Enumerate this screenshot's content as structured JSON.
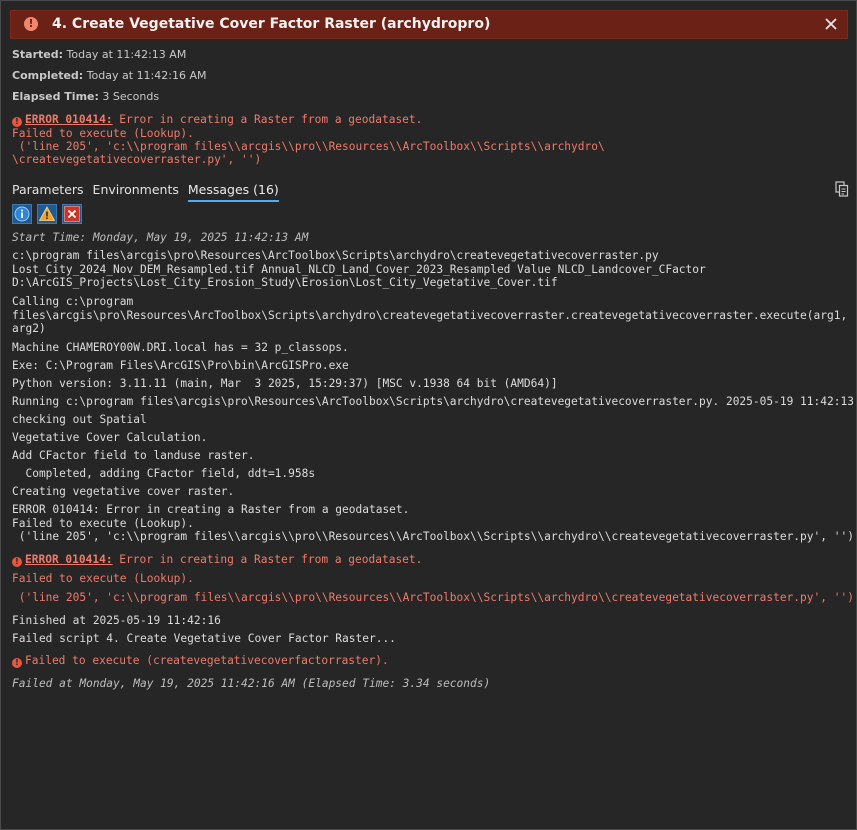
{
  "window": {
    "title": "4. Create Vegetative Cover Factor Raster (archydropro)"
  },
  "meta": {
    "started_label": "Started:",
    "started_value": "Today at 11:42:13 AM",
    "completed_label": "Completed:",
    "completed_value": "Today at 11:42:16 AM",
    "elapsed_label": "Elapsed Time:",
    "elapsed_value": "3 Seconds"
  },
  "summary_error": {
    "code": "ERROR 010414:",
    "text": " Error in creating a Raster from a geodataset.",
    "line2": "Failed to execute (Lookup).",
    "line3": " ('line 205', 'c:\\\\program files\\\\arcgis\\\\pro\\\\Resources\\\\ArcToolbox\\\\Scripts\\\\archydro\\",
    "line4": "\\createvegetativecoverraster.py', '')"
  },
  "tabs": [
    {
      "label": "Parameters"
    },
    {
      "label": "Environments"
    },
    {
      "label": "Messages (16)"
    }
  ],
  "filters": {
    "info_icon": "info-icon",
    "warning_icon": "warning-icon",
    "error_icon": "error-icon"
  },
  "messages": {
    "start_time": "Start Time: Monday, May 19, 2025 11:42:13 AM",
    "m1_l1": "c:\\program files\\arcgis\\pro\\Resources\\ArcToolbox\\Scripts\\archydro\\createvegetativecoverraster.py",
    "m1_l2": "Lost_City_2024_Nov_DEM_Resampled.tif Annual_NLCD_Land_Cover_2023_Resampled Value NLCD_Landcover_CFactor",
    "m1_l3": "D:\\ArcGIS_Projects\\Lost_City_Erosion_Study\\Erosion\\Lost_City_Vegetative_Cover.tif",
    "m2_l1": "Calling c:\\program",
    "m2_l2": "files\\arcgis\\pro\\Resources\\ArcToolbox\\Scripts\\archydro\\createvegetativecoverraster.createvegetativecoverraster.execute(arg1,",
    "m2_l3": "arg2)",
    "m3": "Machine CHAMEROY00W.DRI.local has = 32 p_classops.",
    "m4": "Exe: C:\\Program Files\\ArcGIS\\Pro\\bin\\ArcGISPro.exe",
    "m5": "Python version: 3.11.11 (main, Mar  3 2025, 15:29:37) [MSC v.1938 64 bit (AMD64)]",
    "m6": "Running c:\\program files\\arcgis\\pro\\Resources\\ArcToolbox\\Scripts\\archydro\\createvegetativecoverraster.py. 2025-05-19 11:42:13",
    "m7": "checking out Spatial",
    "m8": "Vegetative Cover Calculation.",
    "m9": "Add CFactor field to landuse raster.",
    "m10": "  Completed, adding CFactor field, ddt=1.958s",
    "m11": "Creating vegetative cover raster.",
    "m12_l1": "ERROR 010414: Error in creating a Raster from a geodataset.",
    "m12_l2": "Failed to execute (Lookup).",
    "m12_l3": " ('line 205', 'c:\\\\program files\\\\arcgis\\\\pro\\\\Resources\\\\ArcToolbox\\\\Scripts\\\\archydro\\\\createvegetativecoverraster.py', '')",
    "e1_code": "ERROR 010414:",
    "e1_text": " Error in creating a Raster from a geodataset.",
    "e1_l2": "Failed to execute (Lookup).",
    "e1_l3": " ('line 205', 'c:\\\\program files\\\\arcgis\\\\pro\\\\Resources\\\\ArcToolbox\\\\Scripts\\\\archydro\\\\createvegetativecoverraster.py', '')",
    "m13": "Finished at 2025-05-19 11:42:16",
    "m14": "Failed script 4. Create Vegetative Cover Factor Raster...",
    "e2": "Failed to execute (createvegetativecoverfactorraster).",
    "end_time": "Failed at Monday, May 19, 2025 11:42:16 AM (Elapsed Time: 3.34 seconds)"
  },
  "colors": {
    "title_bar": "#6b2116",
    "error_text": "#ef7a6a",
    "tab_underline": "#5aa8e6",
    "background": "#262626"
  }
}
